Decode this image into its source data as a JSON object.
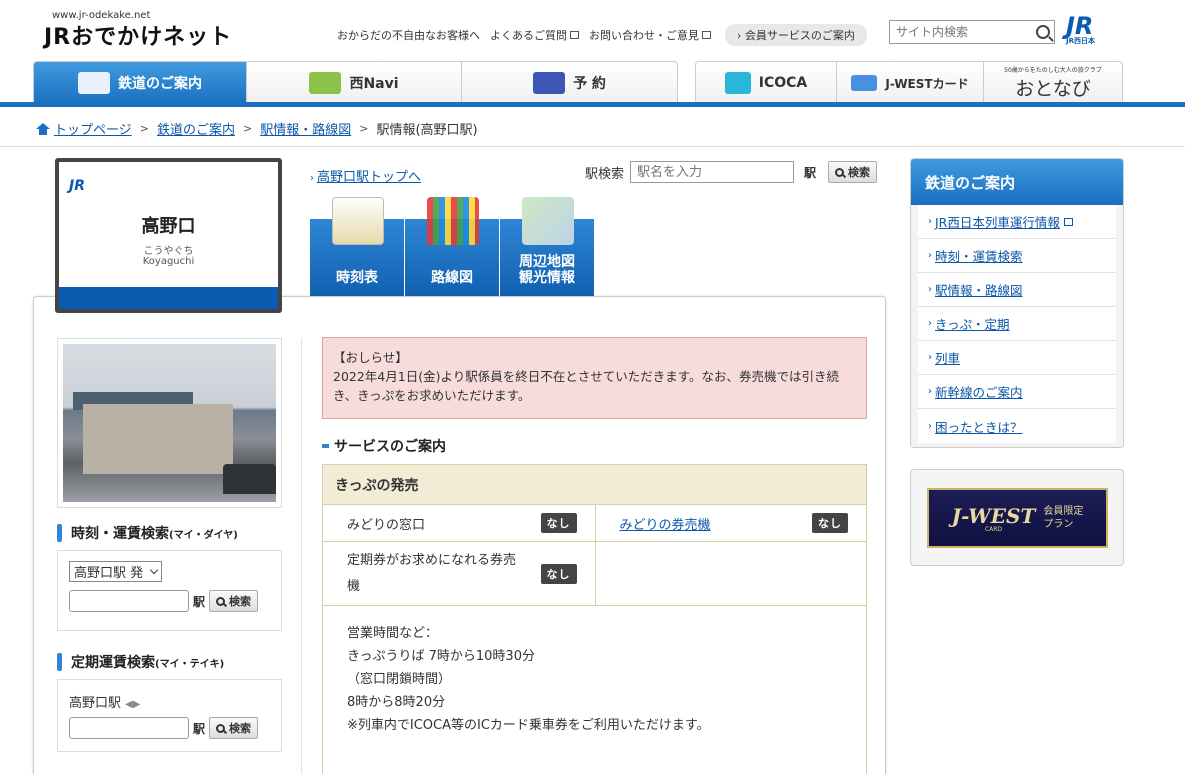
{
  "header": {
    "site_url": "www.jr-odekake.net",
    "logo": "JRおでかけネット",
    "top_links": [
      "おからだの不自由なお客様へ",
      "よくあるご質問",
      "お問い合わせ・ご意見"
    ],
    "member_link": "会員サービスのご案内",
    "search_placeholder": "サイト内検索",
    "jr_west_logo": "JR",
    "jr_west_sub": "JR西日本"
  },
  "nav": {
    "items": [
      "鉄道のご案内",
      "西Navi",
      "予 約",
      "ICOCA",
      "J-WESTカード",
      "おとなび"
    ],
    "otonabi_tag": "50歳からをたのしむ大人の旅クラブ"
  },
  "breadcrumb": [
    "トップページ",
    "鉄道のご案内",
    "駅情報・路線図",
    "駅情報(高野口駅)"
  ],
  "station": {
    "sign_logo": "JR",
    "name": "高野口",
    "kana": "こうやぐち",
    "romaji": "Koyaguchi",
    "top_link": "高野口駅トップへ",
    "search_label": "駅検索",
    "search_placeholder": "駅名を入力",
    "eki": "駅",
    "search_button": "検索",
    "tabs": [
      "時刻表",
      "路線図",
      "周辺地図 観光情報"
    ]
  },
  "left": {
    "timetable_title": "時刻・運賃検索",
    "timetable_sub": "(マイ・ダイヤ)",
    "select_value": "高野口駅 発",
    "commuter_title": "定期運賃検索",
    "commuter_sub": "(マイ・テイキ)",
    "commuter_station": "高野口駅",
    "eki": "駅",
    "search_button": "検索"
  },
  "notice": {
    "title": "【おしらせ】",
    "body": "2022年4月1日(金)より駅係員を終日不在とさせていただきます。なお、券売機では引き続き、きっぷをお求めいただけます。"
  },
  "services": {
    "section_title": "サービスのご案内",
    "table_head": "きっぷの発売",
    "rows": [
      [
        {
          "label": "みどりの窓口",
          "badge": "なし"
        },
        {
          "label": "みどりの券売機",
          "badge": "なし"
        }
      ],
      [
        {
          "label": "定期券がお求めになれる券売機",
          "badge": "なし"
        },
        {
          "label": "",
          "badge": ""
        }
      ]
    ],
    "hours": [
      "営業時間など：",
      "きっぷうりば 7時から10時30分",
      "（窓口閉鎖時間）",
      "8時から8時20分",
      "※列車内でICOCA等のICカード乗車券をご利用いただけます。"
    ]
  },
  "right": {
    "title": "鉄道のご案内",
    "items": [
      "JR西日本列車運行情報",
      "時刻・運賃検索",
      "駅情報・路線図",
      "きっぷ・定期",
      "列車",
      "新幹線のご案内",
      "困ったときは？"
    ],
    "banner_big": "J-WEST",
    "banner_card": "CARD",
    "banner_small_1": "会員限定",
    "banner_small_2": "プラン"
  }
}
